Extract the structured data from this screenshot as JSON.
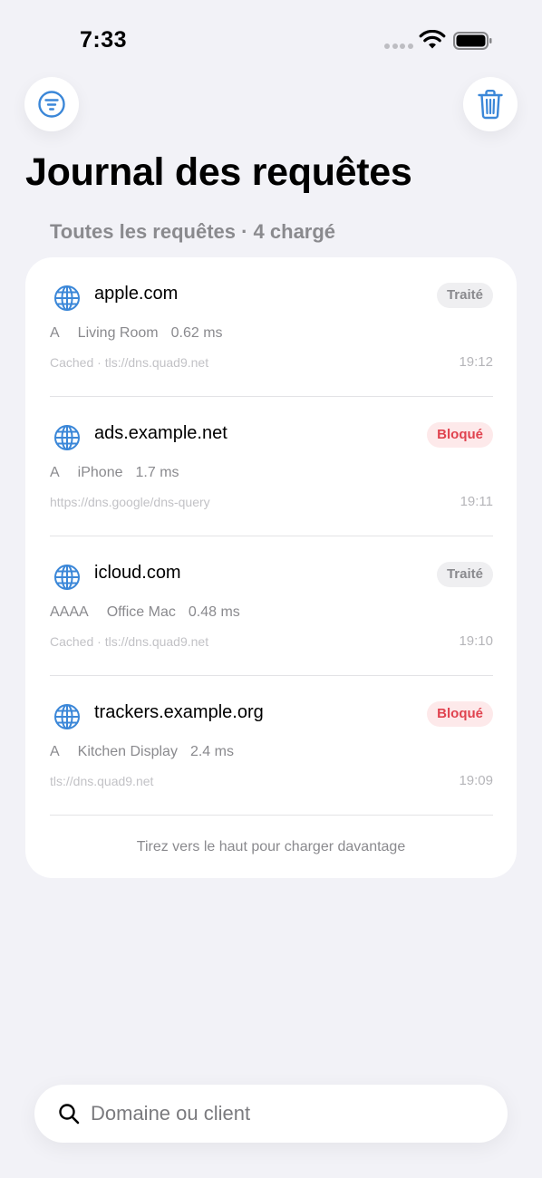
{
  "status_bar": {
    "time": "7:33"
  },
  "title": "Journal des requêtes",
  "section_header": "Toutes les requêtes · 4 chargé",
  "colors": {
    "accent": "#3b87d8",
    "blocked": "#e0434f",
    "background": "#f2f2f7"
  },
  "icons": {
    "filter": "filter-icon",
    "trash": "trash-icon",
    "globe": "globe-icon",
    "search": "search-icon"
  },
  "requests": [
    {
      "domain": "apple.com",
      "status": "Traité",
      "type": "A",
      "client": "Living Room",
      "latency": "0.62 ms",
      "upstream": "Cached · tls://dns.quad9.net",
      "time": "19:12"
    },
    {
      "domain": "ads.example.net",
      "status": "Bloqué",
      "type": "A",
      "client": "iPhone",
      "latency": "1.7 ms",
      "upstream": "https://dns.google/dns-query",
      "time": "19:11"
    },
    {
      "domain": "icloud.com",
      "status": "Traité",
      "type": "AAAA",
      "client": "Office Mac",
      "latency": "0.48 ms",
      "upstream": "Cached · tls://dns.quad9.net",
      "time": "19:10"
    },
    {
      "domain": "trackers.example.org",
      "status": "Bloqué",
      "type": "A",
      "client": "Kitchen Display",
      "latency": "2.4 ms",
      "upstream": "tls://dns.quad9.net",
      "time": "19:09"
    }
  ],
  "load_more": "Tirez vers le haut pour charger davantage",
  "search": {
    "placeholder": "Domaine ou client",
    "value": ""
  }
}
